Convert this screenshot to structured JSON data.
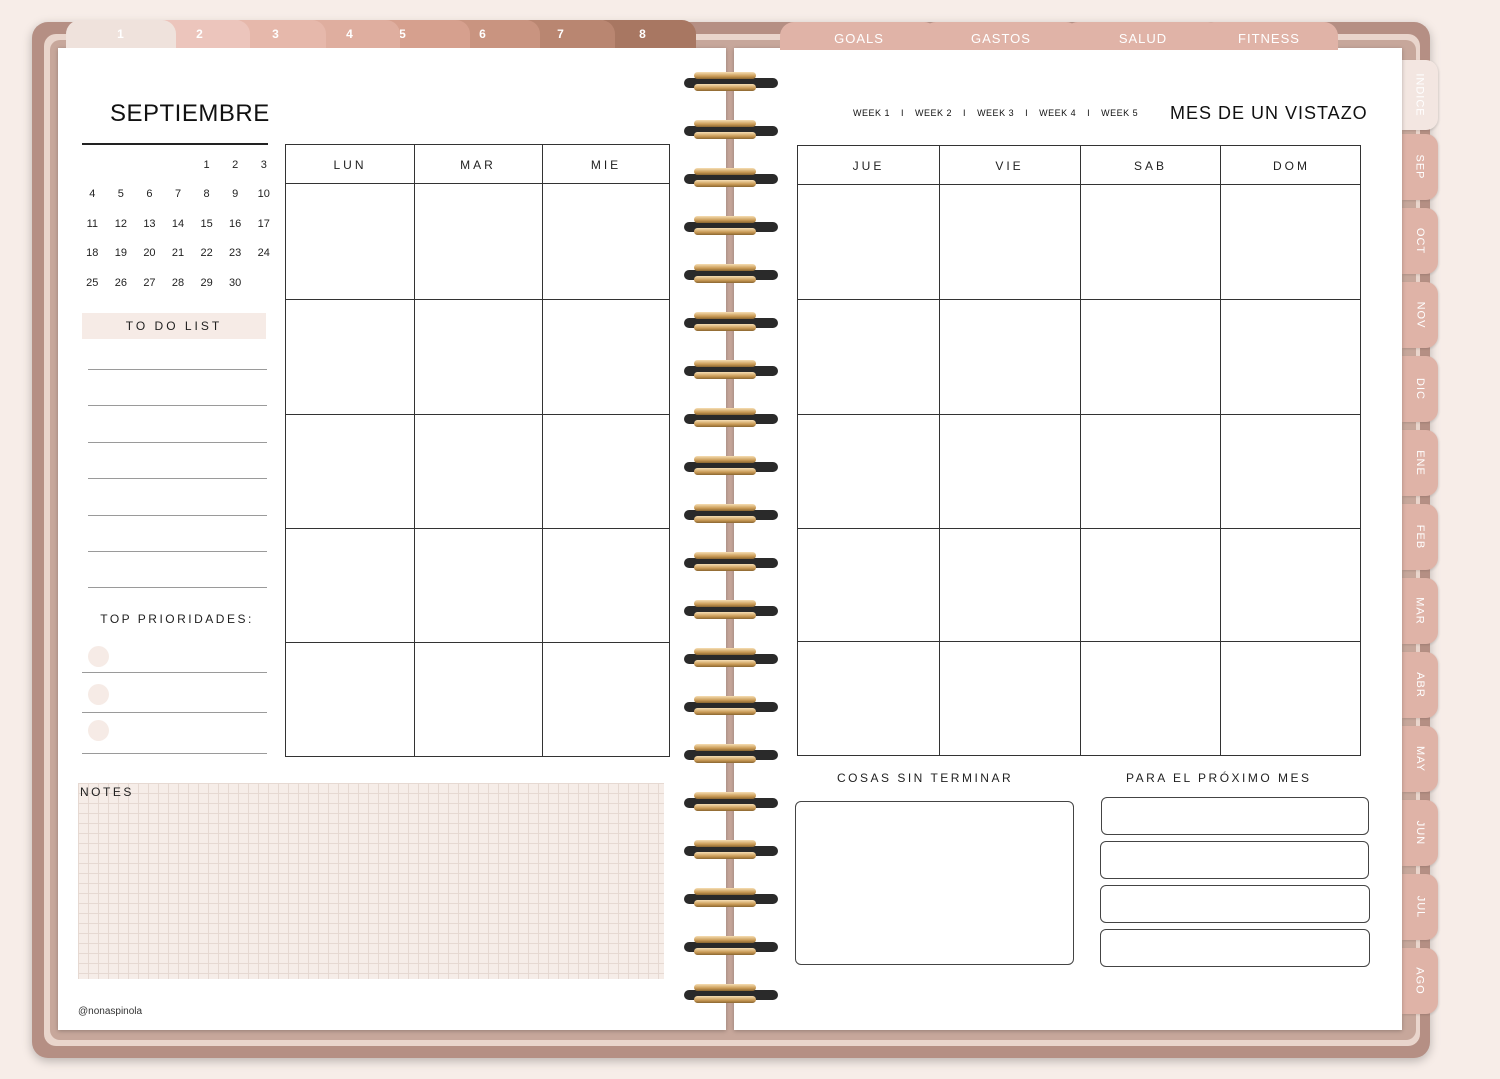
{
  "number_tabs": [
    {
      "label": "1",
      "color": "#efe2dc"
    },
    {
      "label": "2",
      "color": "#ecc5bc"
    },
    {
      "label": "3",
      "color": "#e6b8ab"
    },
    {
      "label": "4",
      "color": "#dfae9f"
    },
    {
      "label": "5",
      "color": "#d6a08e"
    },
    {
      "label": "6",
      "color": "#c99480"
    },
    {
      "label": "7",
      "color": "#b98671"
    },
    {
      "label": "8",
      "color": "#a87762"
    }
  ],
  "section_tabs": [
    "GOALS",
    "GASTOS",
    "SALUD",
    "FITNESS"
  ],
  "side_tabs": [
    "INDICE",
    "SEP",
    "OCT",
    "NOV",
    "DIC",
    "ENE",
    "FEB",
    "MAR",
    "ABR",
    "MAY",
    "JUN",
    "JUL",
    "AGO"
  ],
  "left": {
    "month_title": "SEPTIEMBRE",
    "mini_calendar": [
      [
        "",
        "",
        "",
        "",
        "1",
        "2",
        "3"
      ],
      [
        "4",
        "5",
        "6",
        "7",
        "8",
        "9",
        "10"
      ],
      [
        "11",
        "12",
        "13",
        "14",
        "15",
        "16",
        "17"
      ],
      [
        "18",
        "19",
        "20",
        "21",
        "22",
        "23",
        "24"
      ],
      [
        "25",
        "26",
        "27",
        "28",
        "29",
        "30",
        ""
      ]
    ],
    "todo_heading": "TO DO LIST",
    "priorities_heading": "TOP PRIORIDADES:",
    "days": [
      "LUN",
      "MAR",
      "MIE"
    ],
    "notes_label": "NOTES",
    "credit": "@nonaspinola"
  },
  "right": {
    "weeks": [
      "WEEK 1",
      "WEEK 2",
      "WEEK 3",
      "WEEK 4",
      "WEEK 5"
    ],
    "week_separator": "I",
    "glance_title": "MES DE UN VISTAZO",
    "days": [
      "JUE",
      "VIE",
      "SAB",
      "DOM"
    ],
    "unfinished_heading": "COSAS SIN TERMINAR",
    "next_month_heading": "PARA EL PRÓXIMO MES"
  }
}
